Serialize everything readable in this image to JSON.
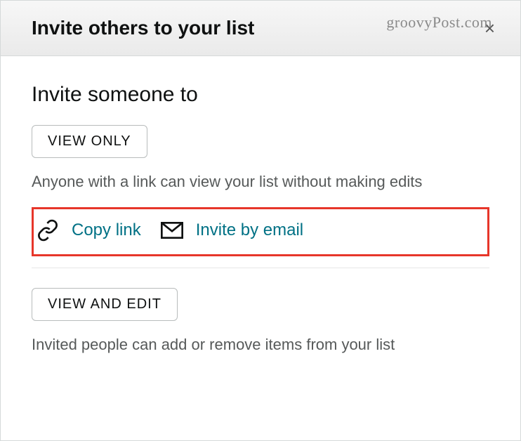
{
  "header": {
    "title": "Invite others to your list",
    "watermark": "groovyPost.com",
    "close_label": "×"
  },
  "section": {
    "title": "Invite someone to"
  },
  "viewOnly": {
    "button_label": "VIEW ONLY",
    "description": "Anyone with a link can view your list without making edits",
    "copy_link_label": "Copy link",
    "invite_email_label": "Invite by email"
  },
  "viewEdit": {
    "button_label": "VIEW AND EDIT",
    "description": "Invited people can add or remove items from your list"
  }
}
